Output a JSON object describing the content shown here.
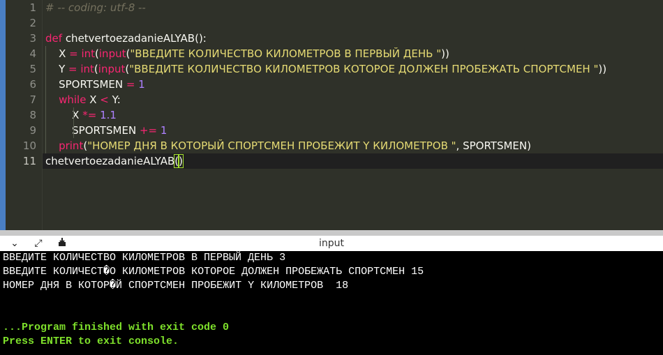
{
  "editor": {
    "lines": [
      {
        "num": "1",
        "parts": [
          {
            "t": "# -- coding: utf-8 --",
            "c": "c-comment"
          }
        ]
      },
      {
        "num": "2",
        "parts": []
      },
      {
        "num": "3",
        "parts": [
          {
            "t": "def",
            "c": "c-kw"
          },
          {
            "t": " ",
            "c": "c-id"
          },
          {
            "t": "chetvertoezadanieALYAB",
            "c": "c-id"
          },
          {
            "t": "():",
            "c": "c-id"
          }
        ]
      },
      {
        "num": "4",
        "parts": [
          {
            "t": "    X",
            "c": "c-id"
          },
          {
            "t": " = ",
            "c": "c-op"
          },
          {
            "t": "int",
            "c": "c-kw"
          },
          {
            "t": "(",
            "c": "c-id"
          },
          {
            "t": "input",
            "c": "c-kw"
          },
          {
            "t": "(",
            "c": "c-id"
          },
          {
            "t": "\"ВВЕДИТЕ КОЛИЧЕСТВО КИЛОМЕТРОВ В ПЕРВЫЙ ДЕНЬ \"",
            "c": "c-str"
          },
          {
            "t": "))",
            "c": "c-id"
          }
        ]
      },
      {
        "num": "5",
        "parts": [
          {
            "t": "    Y",
            "c": "c-id"
          },
          {
            "t": " = ",
            "c": "c-op"
          },
          {
            "t": "int",
            "c": "c-kw"
          },
          {
            "t": "(",
            "c": "c-id"
          },
          {
            "t": "input",
            "c": "c-kw"
          },
          {
            "t": "(",
            "c": "c-id"
          },
          {
            "t": "\"ВВЕДИТЕ КОЛИЧЕСТВО КИЛОМЕТРОВ КОТОРОЕ ДОЛЖЕН ПРОБЕЖАТЬ СПОРТСМЕН \"",
            "c": "c-str"
          },
          {
            "t": "))",
            "c": "c-id"
          }
        ]
      },
      {
        "num": "6",
        "parts": [
          {
            "t": "    SPORTSMEN",
            "c": "c-id"
          },
          {
            "t": " = ",
            "c": "c-op"
          },
          {
            "t": "1",
            "c": "c-num"
          }
        ]
      },
      {
        "num": "7",
        "parts": [
          {
            "t": "    ",
            "c": "c-id"
          },
          {
            "t": "while",
            "c": "c-kw"
          },
          {
            "t": " X ",
            "c": "c-id"
          },
          {
            "t": "<",
            "c": "c-op"
          },
          {
            "t": " Y:",
            "c": "c-id"
          }
        ]
      },
      {
        "num": "8",
        "parts": [
          {
            "t": "        X ",
            "c": "c-id"
          },
          {
            "t": "*=",
            "c": "c-op"
          },
          {
            "t": " ",
            "c": "c-id"
          },
          {
            "t": "1.1",
            "c": "c-num"
          }
        ]
      },
      {
        "num": "9",
        "parts": [
          {
            "t": "        SPORTSMEN ",
            "c": "c-id"
          },
          {
            "t": "+=",
            "c": "c-op"
          },
          {
            "t": " ",
            "c": "c-id"
          },
          {
            "t": "1",
            "c": "c-num"
          }
        ]
      },
      {
        "num": "10",
        "parts": [
          {
            "t": "    ",
            "c": "c-id"
          },
          {
            "t": "print",
            "c": "c-kw"
          },
          {
            "t": "(",
            "c": "c-id"
          },
          {
            "t": "\"НОМЕР ДНЯ В КОТОРЫЙ СПОРТСМЕН ПРОБЕЖИТ Y КИЛОМЕТРОВ \"",
            "c": "c-str"
          },
          {
            "t": ", SPORTSMEN)",
            "c": "c-id"
          }
        ]
      },
      {
        "num": "11",
        "parts": [
          {
            "t": "chetvertoezadanieALYAB",
            "c": "c-id"
          },
          {
            "t": "(",
            "c": "c-id bracket-hl"
          },
          {
            "t": ")",
            "c": "c-id bracket-hl"
          }
        ],
        "active": true
      }
    ]
  },
  "console": {
    "title": "input",
    "toolbar": {
      "collapse_icon": "chevron-down-icon",
      "expand_icon": "expand-arrows-icon",
      "download_icon": "download-icon"
    },
    "output": [
      {
        "text": "ВВЕДИТЕ КОЛИЧЕСТВО КИЛОМЕТРОВ В ПЕРВЫЙ ДЕНЬ 3",
        "green": false
      },
      {
        "text": "ВВЕДИТЕ КОЛИЧЕСТ�О КИЛОМЕТРОВ КОТОРОЕ ДОЛЖЕН ПРОБЕЖАТЬ СПОРТСМЕН 15",
        "green": false
      },
      {
        "text": "НОМЕР ДНЯ В КОТОР�Й СПОРТСМЕН ПРОБЕЖИТ Y КИЛОМЕТРОВ  18",
        "green": false
      },
      {
        "text": "",
        "green": false
      },
      {
        "text": "",
        "green": false
      },
      {
        "text": "...Program finished with exit code 0",
        "green": true
      },
      {
        "text": "Press ENTER to exit console.",
        "green": true
      }
    ]
  }
}
